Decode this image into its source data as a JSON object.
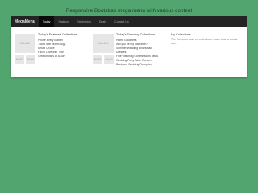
{
  "page": {
    "title": "Responsive Bootstrap mega menu with various content"
  },
  "navbar": {
    "brand": "MegaMenu",
    "items": [
      {
        "label": "Today",
        "active": true
      },
      {
        "label": "Fashion"
      },
      {
        "label": "Electronics"
      },
      {
        "label": "Deals"
      },
      {
        "label": "Contact Us"
      }
    ]
  },
  "menu": {
    "featured": {
      "heading": "Today's Featured Collections",
      "big_thumb": "150x150",
      "small_thumbs": [
        "60x60",
        "60x60"
      ],
      "links": [
        "Phone Every Market",
        "Travel with Technology",
        "Smart Choice",
        "Fall in Love with Tech",
        "Greatchoices at a Day"
      ]
    },
    "trending": {
      "heading": "Today's Trending Collections",
      "big_thumb": "150x150",
      "small_thumbs": [
        "60x60",
        "60x60"
      ],
      "links": [
        "Home Goodness",
        "Will you be my Valentine?",
        "Summer Wedding Bridesmaid",
        "Dresses",
        "Fine Watching Commissions Ideas",
        "Wedding Party Table Runners",
        "Backyard Wedding Reception"
      ]
    },
    "collections": {
      "heading": "My Collections",
      "note_text": "The Elements have no collections.",
      "note_link": "Learn how to create one."
    }
  }
}
